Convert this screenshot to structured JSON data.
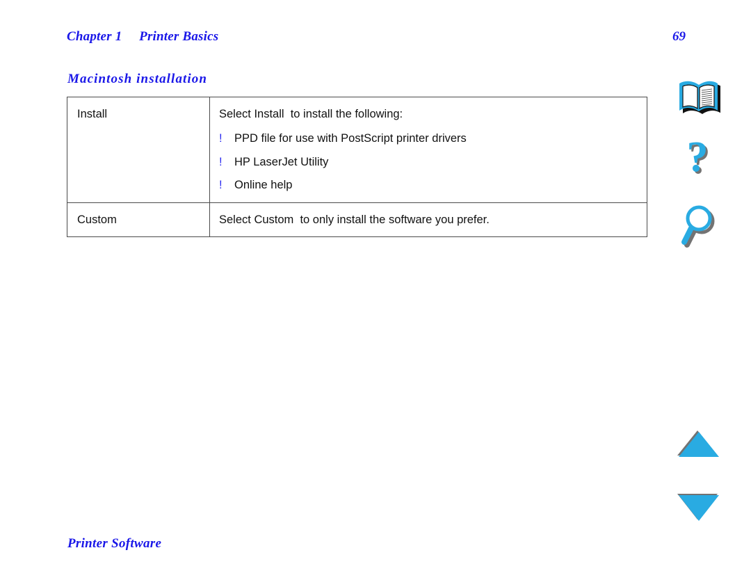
{
  "page": {
    "chapter_label": "Chapter 1     Printer Basics",
    "page_number": "69",
    "heading_color": "#1a17e8",
    "bullet_color": "#2b2bf0",
    "icon_color": "#29abe2",
    "icon_shadow_color": "#737373"
  },
  "section": {
    "heading": "Macintosh installation"
  },
  "table": {
    "rows": [
      {
        "label": "Install",
        "lead": "Select Install  to install the following:",
        "bullets": [
          {
            "mark": "!",
            "text": "PPD file for use with PostScript printer drivers"
          },
          {
            "mark": "!",
            "text": "HP LaserJet Utility"
          },
          {
            "mark": "!",
            "text": "Online help"
          }
        ]
      },
      {
        "label": "Custom",
        "lead": "Select Custom  to only install the software you prefer.",
        "bullets": []
      }
    ]
  },
  "footer": {
    "title": "Printer Software"
  },
  "nav_icons": [
    {
      "name": "book-icon",
      "label": "Contents"
    },
    {
      "name": "question-mark-icon",
      "label": "Help"
    },
    {
      "name": "magnifier-icon",
      "label": "Search"
    },
    {
      "name": "triangle-up-icon",
      "label": "Previous page"
    },
    {
      "name": "triangle-down-icon",
      "label": "Next page"
    }
  ]
}
